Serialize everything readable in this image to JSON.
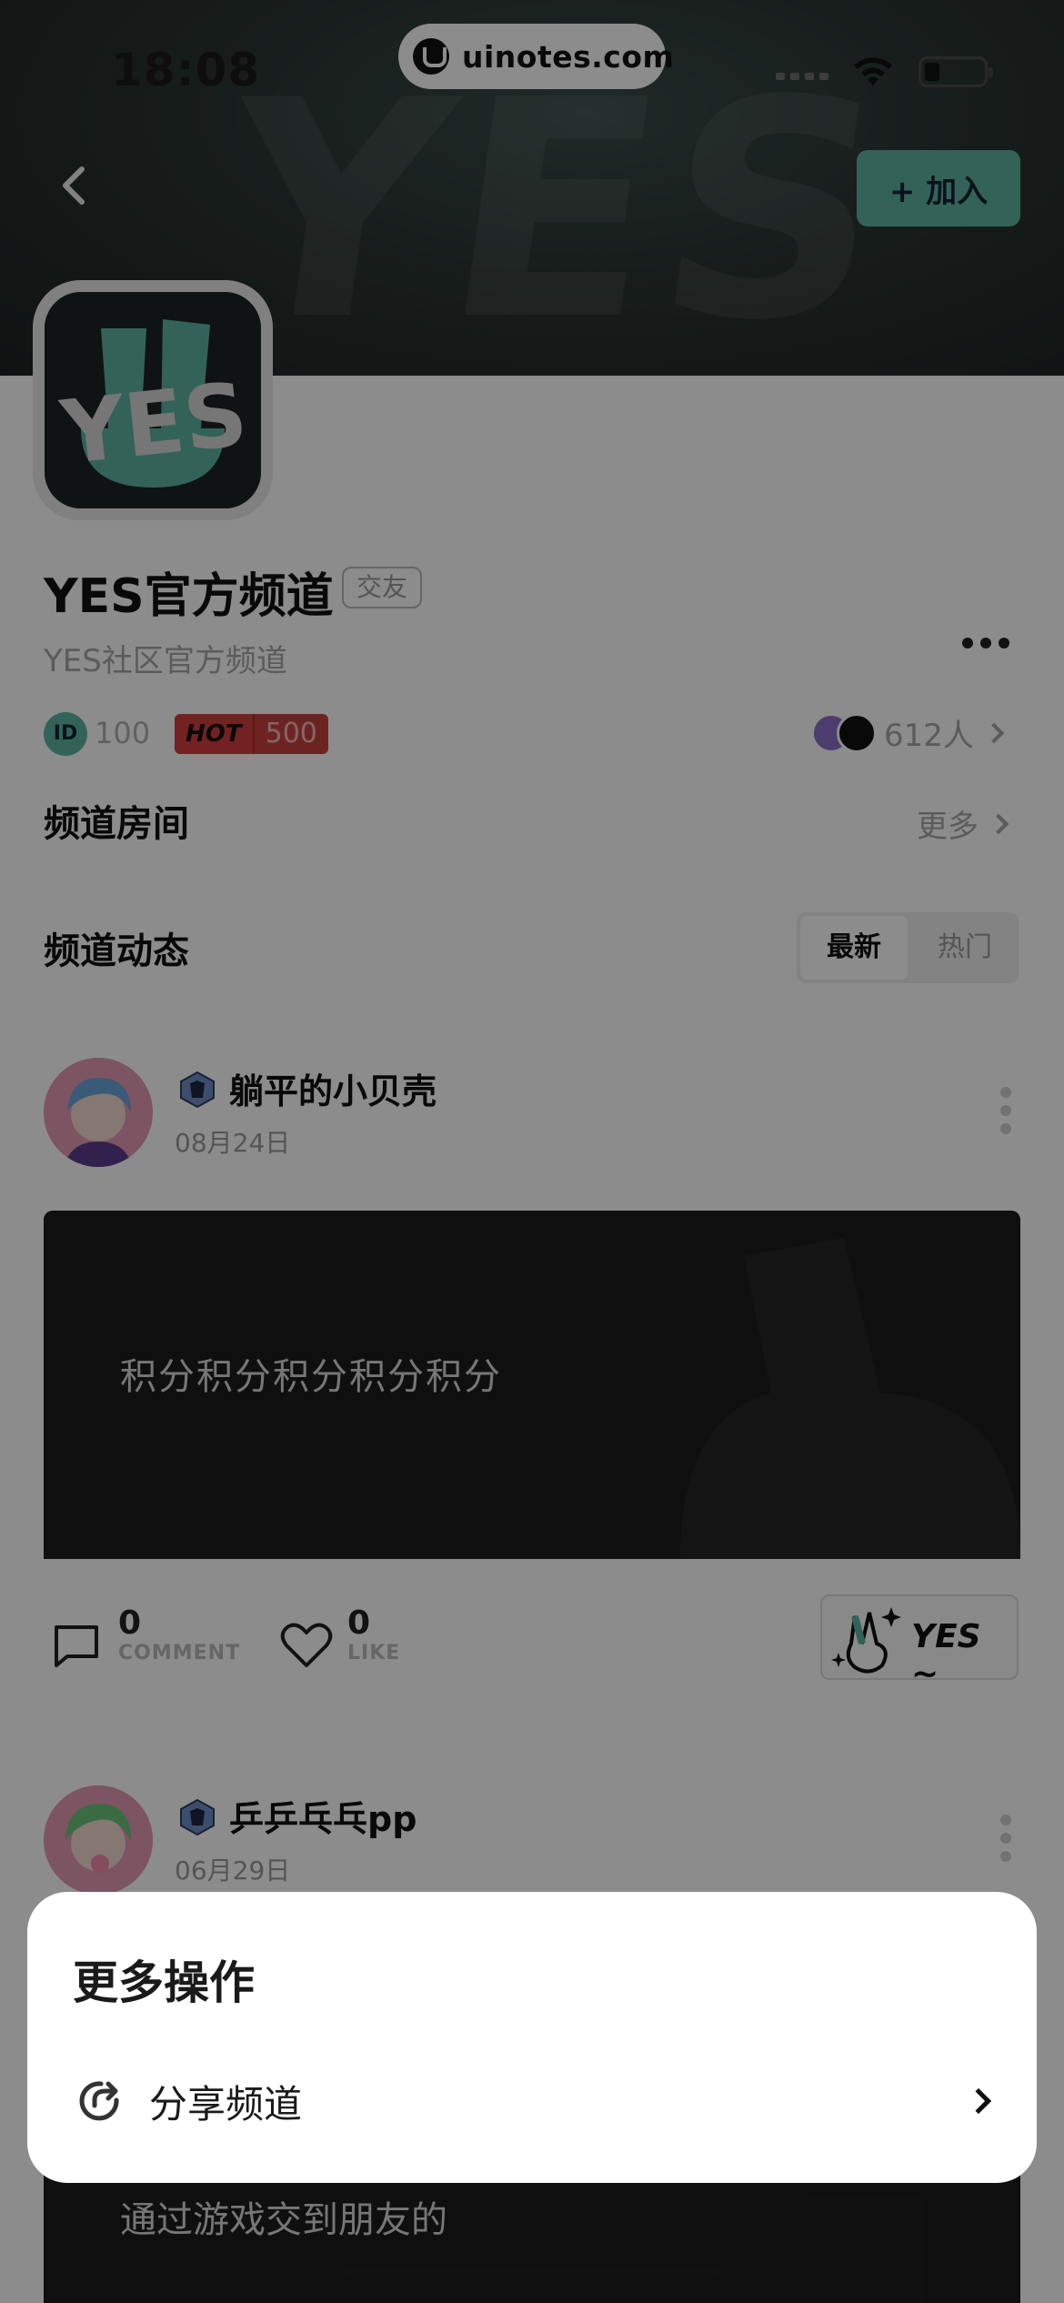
{
  "status_bar": {
    "time": "18:08",
    "url": "uinotes.com"
  },
  "header": {
    "join_label": "+ 加入"
  },
  "channel": {
    "title": "YES官方频道",
    "tag": "交友",
    "description": "YES社区官方频道",
    "id_label": "ID",
    "id_value": "100",
    "hot_label": "HOT",
    "hot_value": "500",
    "member_count": "612人"
  },
  "rooms": {
    "title": "频道房间",
    "more": "更多"
  },
  "feed": {
    "title": "频道动态",
    "tabs": [
      {
        "label": "最新",
        "selected": true
      },
      {
        "label": "热门",
        "selected": false
      }
    ]
  },
  "posts": [
    {
      "author": "躺平的小贝壳",
      "date": "08月24日",
      "text": "积分积分积分积分积分",
      "comments": "0",
      "comment_label": "COMMENT",
      "likes": "0",
      "like_label": "LIKE",
      "sticker": "YES ~"
    },
    {
      "author": "乒乒乓乓pp",
      "date": "06月29日",
      "text": "通过游戏交到朋友的"
    }
  ],
  "sheet": {
    "title": "更多操作",
    "items": [
      {
        "label": "分享频道",
        "icon": "share-icon"
      }
    ]
  },
  "colors": {
    "accent": "#5db5a0",
    "hot": "#d23c3c",
    "dark_card": "#1d1d1d"
  }
}
